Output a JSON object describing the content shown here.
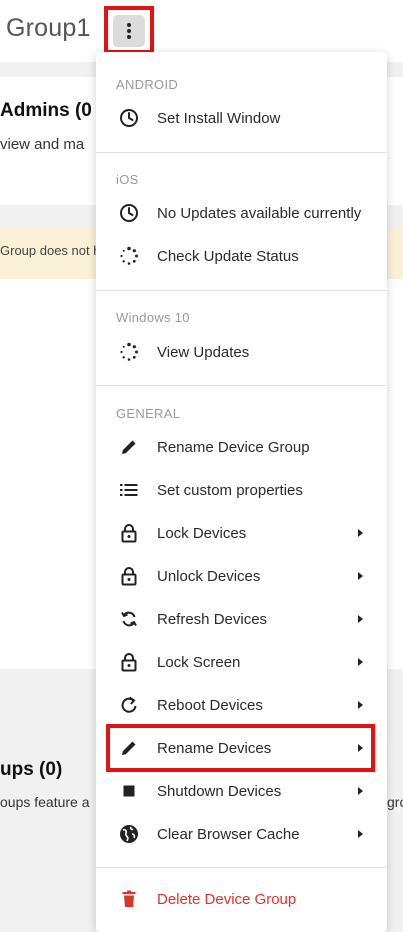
{
  "page": {
    "title": "Group1",
    "admins_title": "Admins (0",
    "admins_desc": "view and ma",
    "warning_text": "Group does not h",
    "groups_title": "ups (0)",
    "groups_desc": "oups feature a",
    "right_fragment": "gro"
  },
  "menu": {
    "sections": {
      "android": "ANDROID",
      "ios": "iOS",
      "windows": "Windows 10",
      "general": "GENERAL"
    },
    "items": {
      "set_install_window": "Set Install Window",
      "no_updates": "No Updates available currently",
      "check_update_status": "Check Update Status",
      "view_updates": "View Updates",
      "rename_device_group": "Rename Device Group",
      "set_custom_properties": "Set custom properties",
      "lock_devices": "Lock Devices",
      "unlock_devices": "Unlock Devices",
      "refresh_devices": "Refresh Devices",
      "lock_screen": "Lock Screen",
      "reboot_devices": "Reboot Devices",
      "rename_devices": "Rename Devices",
      "shutdown_devices": "Shutdown Devices",
      "clear_browser_cache": "Clear Browser Cache",
      "delete_device_group": "Delete Device Group"
    }
  },
  "colors": {
    "highlight": "#e41212",
    "danger": "#d9362b",
    "warning_bg": "#fbf1d7"
  }
}
